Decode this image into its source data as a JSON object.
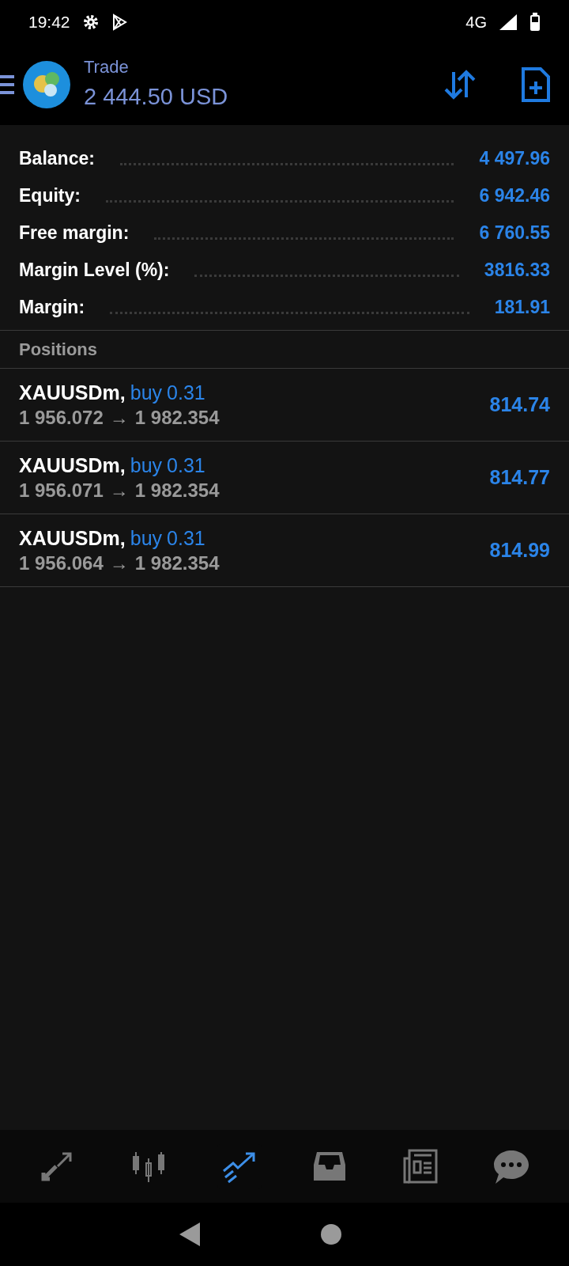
{
  "status_bar": {
    "time": "19:42",
    "network": "4G"
  },
  "header": {
    "title": "Trade",
    "balance": "2 444.50 USD"
  },
  "summary": [
    {
      "label": "Balance:",
      "value": "4 497.96"
    },
    {
      "label": "Equity:",
      "value": "6 942.46"
    },
    {
      "label": "Free margin:",
      "value": "6 760.55"
    },
    {
      "label": "Margin Level (%):",
      "value": "3816.33"
    },
    {
      "label": "Margin:",
      "value": "181.91"
    }
  ],
  "positions": {
    "title": "Positions",
    "rows": [
      {
        "symbol": "XAUUSDm,",
        "type": "buy",
        "volume": "0.31",
        "open_price": "1 956.072",
        "arrow": "→",
        "current_price": "1 982.354",
        "profit": "814.74"
      },
      {
        "symbol": "XAUUSDm,",
        "type": "buy",
        "volume": "0.31",
        "open_price": "1 956.071",
        "arrow": "→",
        "current_price": "1 982.354",
        "profit": "814.77"
      },
      {
        "symbol": "XAUUSDm,",
        "type": "buy",
        "volume": "0.31",
        "open_price": "1 956.064",
        "arrow": "→",
        "current_price": "1 982.354",
        "profit": "814.99"
      }
    ]
  },
  "bottom_nav": [
    {
      "kind": "quotes",
      "selected": false
    },
    {
      "kind": "chart",
      "selected": false
    },
    {
      "kind": "trade",
      "selected": true
    },
    {
      "kind": "inbox",
      "selected": false
    },
    {
      "kind": "news",
      "selected": false
    },
    {
      "kind": "chat",
      "selected": false
    }
  ]
}
